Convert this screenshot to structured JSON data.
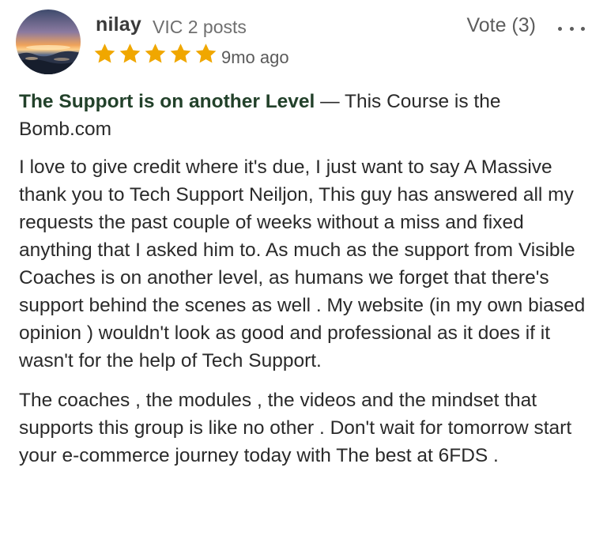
{
  "author": {
    "name": "nilay",
    "location": "VIC",
    "posts": "2 posts"
  },
  "rating": {
    "stars": 5,
    "max": 5,
    "color": "#f0a700"
  },
  "time_ago": "9mo ago",
  "vote": {
    "label": "Vote (3)"
  },
  "more_icon": "ellipsis-icon",
  "review": {
    "title": "The Support is on another Level",
    "separator": " — ",
    "subtitle": "This Course is the Bomb.com",
    "paragraphs": [
      "I love to give credit where it's due, I just want to say A Massive thank you to Tech Support Neiljon, This guy has answered all my requests the past couple of weeks without a miss and fixed anything that I asked him to. As much as the support from Visible Coaches is on another level, as humans we forget that there's support behind the scenes as well . My website (in my own biased opinion ) wouldn't look as good and professional as it does if it wasn't for the help of Tech Support.",
      "The coaches , the modules , the videos and the mindset that supports this group is like no other . Don't wait for tomorrow start your e-commerce journey today with The best at 6FDS ."
    ]
  },
  "colors": {
    "title": "#22412a",
    "star": "#f0a700",
    "meta": "#6f6f6f"
  }
}
